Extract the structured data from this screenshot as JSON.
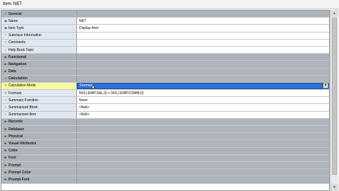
{
  "window": {
    "title": "Item: NET"
  },
  "rows": [
    {
      "label": "General",
      "value": "",
      "kind": "cat",
      "toggle": "▪"
    },
    {
      "label": "Name",
      "value": "NET",
      "kind": "prop",
      "mark": "diamond"
    },
    {
      "label": "Item Type",
      "value": "Display Item",
      "kind": "prop",
      "mark": "diamond"
    },
    {
      "label": "Subclass Information",
      "value": "",
      "kind": "prop",
      "mark": "dot"
    },
    {
      "label": "Comments",
      "value": "",
      "kind": "prop",
      "mark": "dot"
    },
    {
      "label": "Help Book Topic",
      "value": "",
      "kind": "prop",
      "mark": "dot"
    },
    {
      "label": "Functional",
      "value": "",
      "kind": "cat",
      "toggle": "▸"
    },
    {
      "label": "Navigation",
      "value": "",
      "kind": "cat",
      "toggle": "▸"
    },
    {
      "label": "Data",
      "value": "",
      "kind": "cat",
      "toggle": "▸"
    },
    {
      "label": "Calculation",
      "value": "",
      "kind": "cat",
      "toggle": "▪"
    },
    {
      "label": "Calculation Mode",
      "value": "Formula",
      "kind": "prop",
      "mark": "inherit",
      "selected": true
    },
    {
      "label": "Formula",
      "value": "NVL(:EMP.SAL,0) + NVL(:EMP.COMM,0)",
      "kind": "prop",
      "mark": "inherit"
    },
    {
      "label": "Summary Function",
      "value": "None",
      "kind": "prop",
      "mark": "dot"
    },
    {
      "label": "Summarized Block",
      "value": "<Null>",
      "kind": "prop",
      "mark": "dot"
    },
    {
      "label": "Summarized Item",
      "value": "<Null>",
      "kind": "prop",
      "mark": "dot"
    },
    {
      "label": "Records",
      "value": "",
      "kind": "cat",
      "toggle": "▸"
    },
    {
      "label": "Database",
      "value": "",
      "kind": "cat",
      "toggle": "▸"
    },
    {
      "label": "Physical",
      "value": "",
      "kind": "cat",
      "toggle": "▸"
    },
    {
      "label": "Visual Attributes",
      "value": "",
      "kind": "cat",
      "toggle": "▸"
    },
    {
      "label": "Color",
      "value": "",
      "kind": "cat",
      "toggle": "▸"
    },
    {
      "label": "Font",
      "value": "",
      "kind": "cat",
      "toggle": "▸"
    },
    {
      "label": "Prompt",
      "value": "",
      "kind": "cat",
      "toggle": "▸"
    },
    {
      "label": "Prompt Color",
      "value": "",
      "kind": "cat",
      "toggle": "▸"
    },
    {
      "label": "Prompt Font",
      "value": "",
      "kind": "cat",
      "toggle": "▸"
    }
  ],
  "marks": {
    "diamond": "◆",
    "dot": "▪",
    "inherit": "+"
  },
  "dropdown": {
    "arrow": "▼"
  },
  "scrollbar": {
    "up": "▲",
    "down": "▼"
  }
}
